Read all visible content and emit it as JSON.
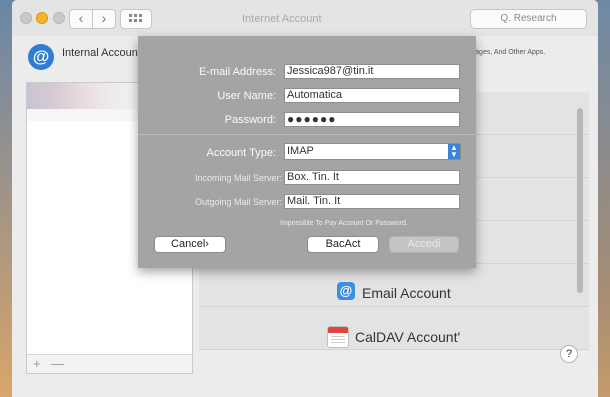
{
  "window": {
    "title": "Internet Account",
    "search_placeholder": "Q. Research",
    "nav_back": "‹",
    "nav_fwd": "›"
  },
  "header": {
    "title": "Internal Accounts",
    "right_text": "Ssages, And Other Apps."
  },
  "sheet": {
    "email_label": "E-mail Address:",
    "email_value": "Jessica987@tin.it",
    "username_label": "User Name:",
    "username_value": "Automatica",
    "password_label": "Password:",
    "password_value": "●●●●●●",
    "account_type_label": "Account Type:",
    "account_type_value": "IMAP",
    "incoming_label": "Incoming Mail Server:",
    "incoming_value": "Box. Tin. It",
    "outgoing_label": "Outgoing Mail Server:",
    "outgoing_value": "Mail. Tin. It",
    "error_text": "Impossible To Pay Account Or Password.",
    "cancel_label": "Cancel›",
    "back_label": "BacAct",
    "access_label": "Accedi"
  },
  "providers": {
    "email": "Email Account",
    "caldav": "CalDAV Account'"
  },
  "list_footer": {
    "add": "+",
    "remove": "—"
  },
  "help": "?"
}
